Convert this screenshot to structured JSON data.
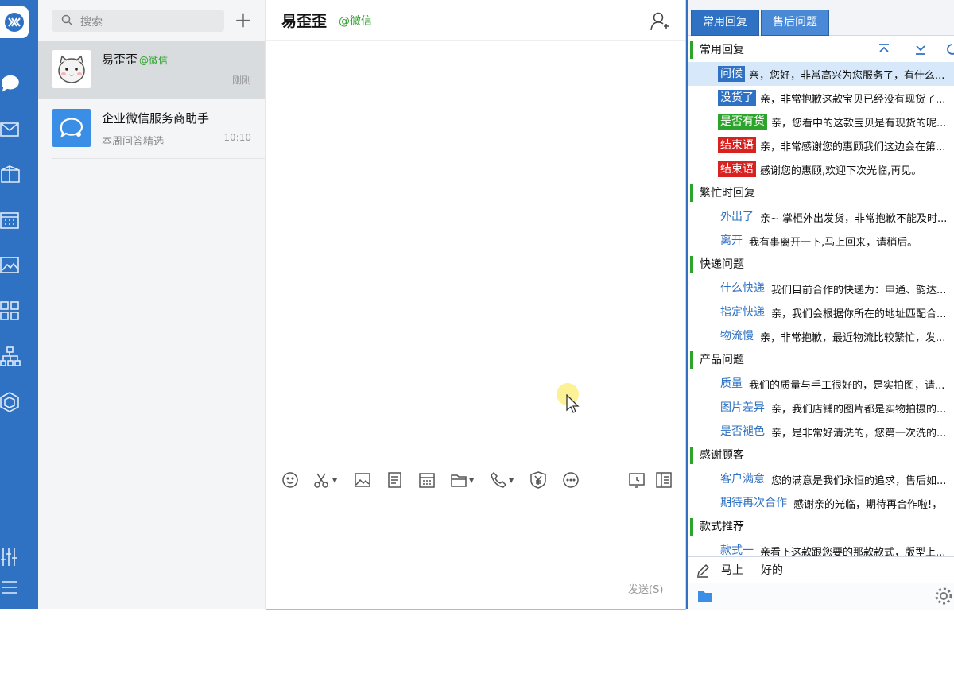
{
  "sidebar": {
    "icons": [
      "logo-icon",
      "chat-icon",
      "mail-icon",
      "box-icon",
      "calendar-icon",
      "image-icon",
      "apps-icon",
      "org-icon",
      "cube-icon",
      "settings-sliders-icon",
      "menu-icon"
    ]
  },
  "list": {
    "search_placeholder": "搜索",
    "add_label": "+",
    "conversations": [
      {
        "name": "易歪歪",
        "source": "@微信",
        "time": "刚刚",
        "preview": ""
      },
      {
        "name": "企业微信服务商助手",
        "source": "",
        "time": "10:10",
        "preview": "本周问答精选"
      }
    ]
  },
  "chat": {
    "title": "易歪歪",
    "title_source": "@微信",
    "send_label": "发送(S)",
    "toolbar_icons": [
      "emoji-icon",
      "scissors-icon",
      "image-icon",
      "document-icon",
      "calendar-icon",
      "folder-icon",
      "phone-icon",
      "yuan-icon",
      "more-icon",
      "history-icon",
      "sidebar-toggle-icon"
    ]
  },
  "quick_reply": {
    "tabs": [
      {
        "label": "常用回复"
      },
      {
        "label": "售后问题"
      }
    ],
    "categories": [
      {
        "name": "常用回复",
        "items": [
          {
            "tag": "问候",
            "style": "blue-solid",
            "text": "亲，您好，非常高兴为您服务了，有什么..."
          },
          {
            "tag": "没货了",
            "style": "blue-solid",
            "text": "亲，非常抱歉这款宝贝已经没有现货了..."
          },
          {
            "tag": "是否有货",
            "style": "green-solid",
            "text": "亲，您看中的这款宝贝是有现货的呢..."
          },
          {
            "tag": "结束语",
            "style": "red-solid",
            "text": "亲，非常感谢您的惠顾我们这边会在第..."
          },
          {
            "tag": "结束语",
            "style": "red-solid",
            "text": "感谢您的惠顾,欢迎下次光临,再见。"
          }
        ]
      },
      {
        "name": "繁忙时回复",
        "items": [
          {
            "tag": "外出了",
            "style": "plain",
            "text": "亲~ 掌柜外出发货，非常抱歉不能及时..."
          },
          {
            "tag": "离开",
            "style": "plain",
            "text": "我有事离开一下,马上回来，请稍后。"
          }
        ]
      },
      {
        "name": "快递问题",
        "items": [
          {
            "tag": "什么快递",
            "style": "plain",
            "text": "我们目前合作的快递为：申通、韵达..."
          },
          {
            "tag": "指定快递",
            "style": "plain",
            "text": "亲，我们会根据你所在的地址匹配合..."
          },
          {
            "tag": "物流慢",
            "style": "plain",
            "text": "亲，非常抱歉，最近物流比较繁忙，发..."
          }
        ]
      },
      {
        "name": "产品问题",
        "items": [
          {
            "tag": "质量",
            "style": "plain",
            "text": "我们的质量与手工很好的，是实拍图，请..."
          },
          {
            "tag": "图片差异",
            "style": "plain",
            "text": "亲，我们店铺的图片都是实物拍摄的..."
          },
          {
            "tag": "是否褪色",
            "style": "plain",
            "text": "亲，是非常好清洗的，您第一次洗的..."
          }
        ]
      },
      {
        "name": "感谢顾客",
        "items": [
          {
            "tag": "客户满意",
            "style": "plain",
            "text": "您的满意是我们永恒的追求，售后如..."
          },
          {
            "tag": "期待再次合作",
            "style": "plain",
            "text": "感谢亲的光临，期待再合作啦!，"
          }
        ]
      },
      {
        "name": "款式推荐",
        "items": [
          {
            "tag": "款式一",
            "style": "plain",
            "text": "亲看下这款跟您要的那款款式，版型上..."
          }
        ]
      }
    ],
    "input_words": [
      "马上",
      "好的"
    ]
  },
  "colors": {
    "accent": "#2f72c4",
    "green": "#2ca32a",
    "red": "#d8221f",
    "highlight": "#d6e8f9"
  }
}
